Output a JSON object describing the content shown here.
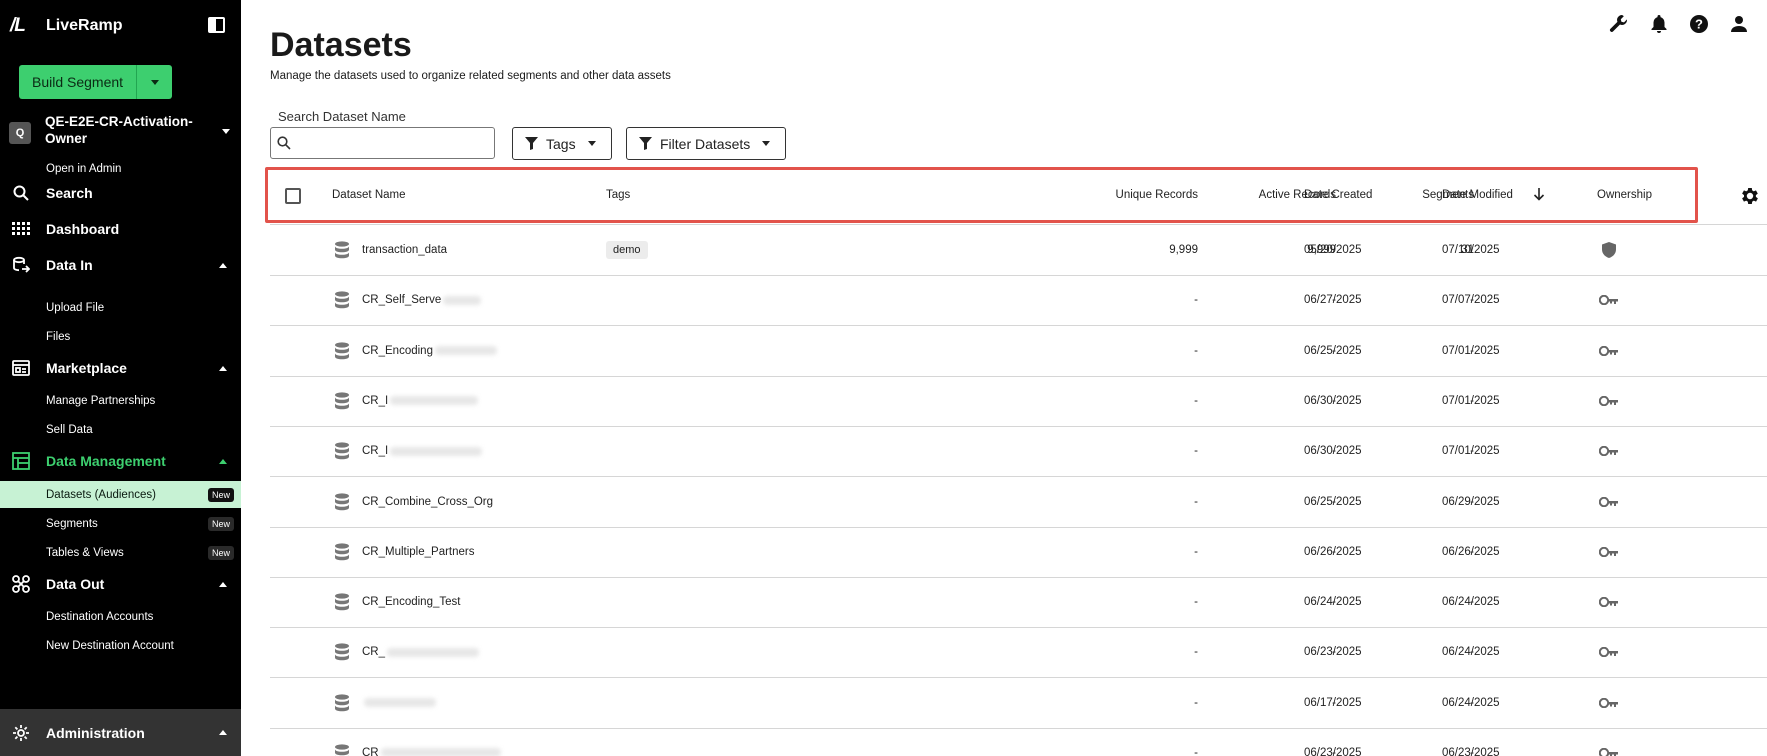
{
  "brand": {
    "logo_text": "/L",
    "name": "LiveRamp"
  },
  "sidebar": {
    "build_button": "Build Segment",
    "org": {
      "initial": "Q",
      "name": "QE-E2E-CR-Activation-Owner"
    },
    "open_admin": "Open in Admin",
    "search": "Search",
    "dashboard": "Dashboard",
    "data_in": {
      "label": "Data In",
      "items": [
        "Upload File",
        "Files"
      ]
    },
    "marketplace": {
      "label": "Marketplace",
      "items": [
        "Manage Partnerships",
        "Sell Data"
      ]
    },
    "data_management": {
      "label": "Data Management",
      "items": [
        {
          "label": "Datasets (Audiences)",
          "badge": "New"
        },
        {
          "label": "Segments",
          "badge": "New"
        },
        {
          "label": "Tables & Views",
          "badge": "New"
        }
      ]
    },
    "data_out": {
      "label": "Data Out",
      "items": [
        "Destination Accounts",
        "New Destination Account"
      ]
    },
    "administration": "Administration",
    "accent_color": "#3dcf6f"
  },
  "page": {
    "title": "Datasets",
    "subtitle": "Manage the datasets used to organize related segments and other data assets",
    "search_label": "Search Dataset Name",
    "search_placeholder": "",
    "tags_filter": "Tags",
    "filter_datasets": "Filter Datasets"
  },
  "table": {
    "headers": {
      "name": "Dataset Name",
      "tags": "Tags",
      "unique": "Unique Records",
      "active": "Active Records",
      "segments": "Segments",
      "created": "Date Created",
      "modified": "Date Modified",
      "ownership": "Ownership"
    },
    "sort": {
      "column": "Date Modified",
      "direction": "descending"
    },
    "rows": [
      {
        "name": "transaction_data",
        "tag": "demo",
        "unique": "9,999",
        "active": "9,999",
        "segments": "31",
        "created": "05/20/2025",
        "modified": "07/10/2025",
        "ownership": "shield-icon"
      },
      {
        "name": "CR_Self_Serve",
        "tag": "",
        "unique": "-",
        "active": "-",
        "segments": "-",
        "created": "06/27/2025",
        "modified": "07/07/2025",
        "ownership": "key-icon"
      },
      {
        "name": "CR_Encoding",
        "tag": "",
        "unique": "-",
        "active": "-",
        "segments": "-",
        "created": "06/25/2025",
        "modified": "07/01/2025",
        "ownership": "key-icon"
      },
      {
        "name": "CR_I",
        "tag": "",
        "unique": "-",
        "active": "-",
        "segments": "-",
        "created": "06/30/2025",
        "modified": "07/01/2025",
        "ownership": "key-icon"
      },
      {
        "name": "CR_I",
        "tag": "",
        "unique": "-",
        "active": "-",
        "segments": "-",
        "created": "06/30/2025",
        "modified": "07/01/2025",
        "ownership": "key-icon"
      },
      {
        "name": "CR_Combine_Cross_Org",
        "tag": "",
        "unique": "-",
        "active": "-",
        "segments": "-",
        "created": "06/25/2025",
        "modified": "06/29/2025",
        "ownership": "key-icon"
      },
      {
        "name": "CR_Multiple_Partners",
        "tag": "",
        "unique": "-",
        "active": "-",
        "segments": "-",
        "created": "06/26/2025",
        "modified": "06/26/2025",
        "ownership": "key-icon"
      },
      {
        "name": "CR_Encoding_Test",
        "tag": "",
        "unique": "-",
        "active": "-",
        "segments": "-",
        "created": "06/24/2025",
        "modified": "06/24/2025",
        "ownership": "key-icon"
      },
      {
        "name": "CR_",
        "tag": "",
        "unique": "-",
        "active": "-",
        "segments": "-",
        "created": "06/23/2025",
        "modified": "06/24/2025",
        "ownership": "key-icon"
      },
      {
        "name": "",
        "tag": "",
        "unique": "-",
        "active": "-",
        "segments": "-",
        "created": "06/17/2025",
        "modified": "06/24/2025",
        "ownership": "key-icon"
      },
      {
        "name": "CR",
        "tag": "",
        "unique": "-",
        "active": "-",
        "segments": "-",
        "created": "06/23/2025",
        "modified": "06/23/2025",
        "ownership": "key-icon"
      }
    ]
  },
  "highlight_color": "#e2534b"
}
